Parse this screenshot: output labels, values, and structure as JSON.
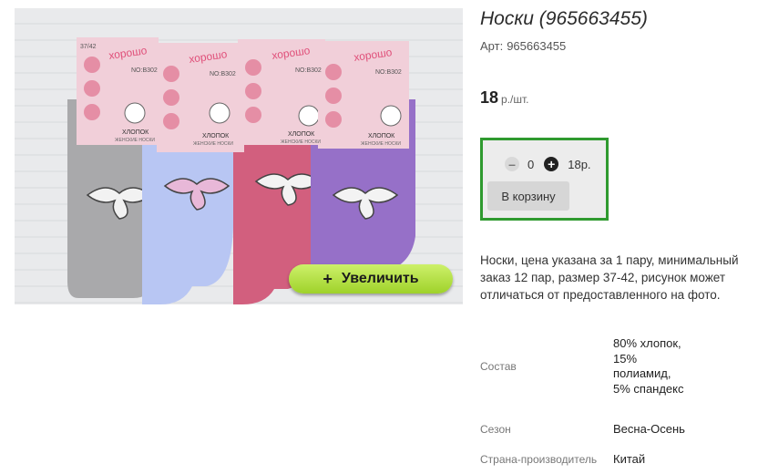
{
  "product": {
    "title": "Носки (965663455)",
    "art_label": "Арт:",
    "art_value": "965663455",
    "price_value": "18",
    "price_unit": "р./шт."
  },
  "cart": {
    "quantity": "0",
    "sum": "18р.",
    "add_label": "В корзину"
  },
  "image": {
    "zoom_label": "Увеличить",
    "zoom_icon": "plus-icon",
    "package_brand": "хорошо",
    "package_size": "37/42",
    "package_code": "NO:B302",
    "package_fabric": "ХЛОПОК",
    "package_sub": "ЖЕНСКИЕ НОСКИ",
    "sock_colors": [
      "#a9a9ab",
      "#b8c6f3",
      "#d25f7e",
      "#9670c8"
    ]
  },
  "description": "Носки, цена указана за 1 пару, минимальный заказ 12 пар, размер 37-42, рисунок может отличаться от предоставленного на фото.",
  "properties": [
    {
      "key": "Состав",
      "value": "80% хлопок, 15% полиамид, 5% спандекс"
    },
    {
      "key": "Сезон",
      "value": "Весна-Осень"
    },
    {
      "key": "Страна-производитель",
      "value": "Китай"
    }
  ],
  "colors": {
    "cart_border": "#2f9a2f",
    "zoom_button": "#b5e14a"
  }
}
